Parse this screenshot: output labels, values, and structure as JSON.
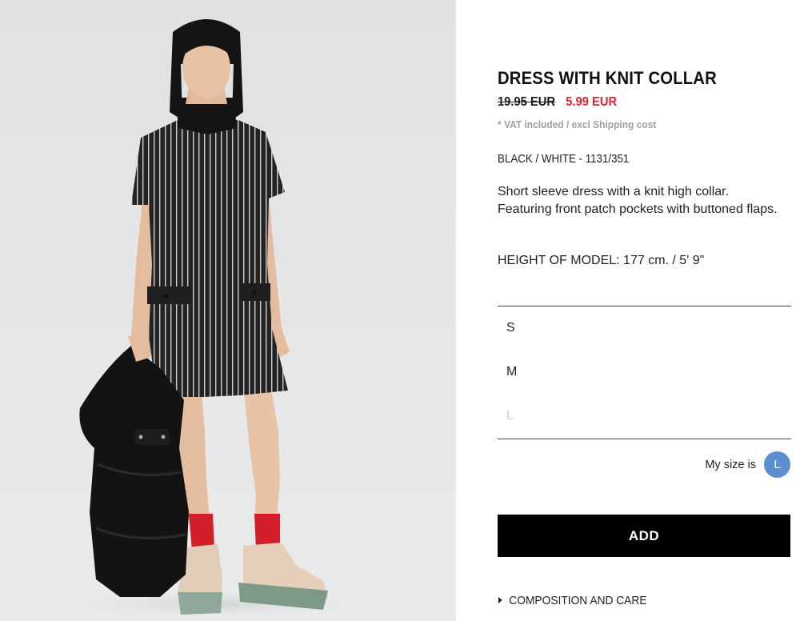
{
  "product": {
    "title": "DRESS WITH KNIT COLLAR",
    "old_price": "19.95 EUR",
    "new_price": "5.99 EUR",
    "vat_note": "* VAT included / excl Shipping cost",
    "color_ref": "BLACK / WHITE - 1131/351",
    "description": "Short sleeve dress with a knit high collar. Featuring front patch pockets with buttoned flaps.",
    "model_height": "HEIGHT OF MODEL: 177 cm. / 5' 9\""
  },
  "sizes": [
    {
      "label": "S",
      "available": true
    },
    {
      "label": "M",
      "available": true
    },
    {
      "label": "L",
      "available": false
    }
  ],
  "my_size": {
    "label": "My size is",
    "value": "L"
  },
  "add_button": {
    "label": "ADD"
  },
  "composition": {
    "label": "COMPOSITION AND CARE"
  },
  "colors": {
    "sale_red": "#e4222e",
    "badge_blue": "#5b8fd1",
    "button_black": "#000000",
    "muted_grey": "#a0a0a0"
  }
}
